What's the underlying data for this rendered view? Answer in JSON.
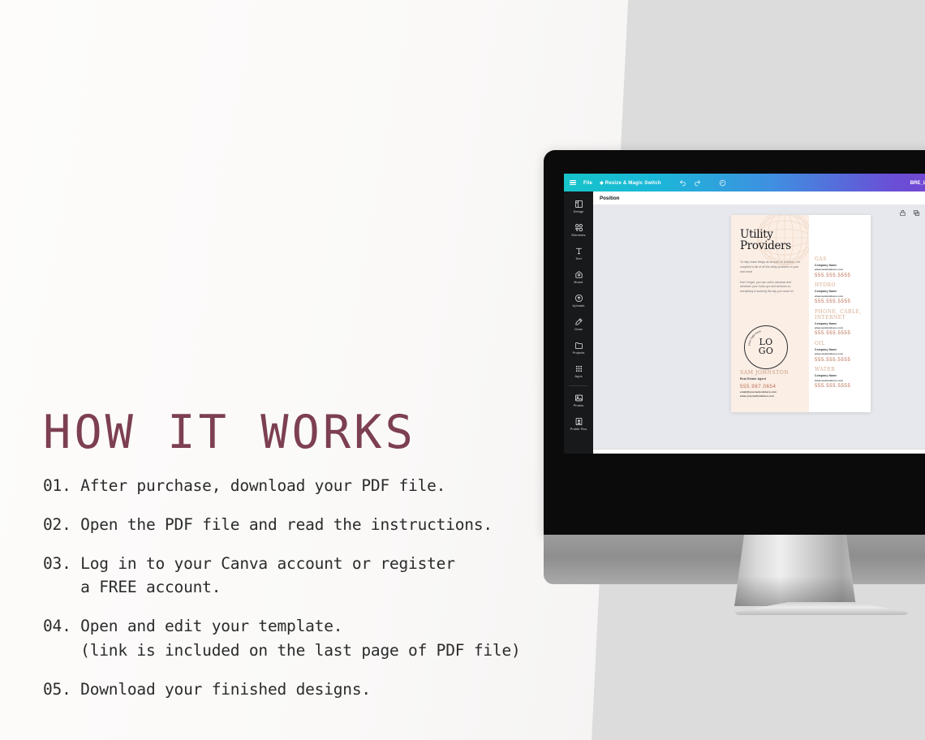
{
  "headline": "HOW IT WORKS",
  "accent_color": "#7d3f52",
  "steps": [
    "01. After purchase, download your PDF file.",
    "02. Open the PDF file and read the instructions.",
    "03. Log in to your Canva account or register\n    a FREE account.",
    "04. Open and edit your template.\n    (link is included on the last page of PDF file)",
    "05. Download your finished designs."
  ],
  "editor": {
    "topbar": {
      "menu_icon": "hamburger-icon",
      "file_label": "File",
      "resize_label": "Resize & Magic Switch",
      "undo_icon": "undo-icon",
      "redo_icon": "redo-icon",
      "cloud_icon": "cloud-sync-icon",
      "document_title": "BRE_LM_Utility-Provid"
    },
    "sidebar": [
      {
        "label": "Design",
        "icon": "design-icon"
      },
      {
        "label": "Elements",
        "icon": "elements-icon"
      },
      {
        "label": "Text",
        "icon": "text-icon"
      },
      {
        "label": "Brand",
        "icon": "brand-icon"
      },
      {
        "label": "Uploads",
        "icon": "uploads-icon"
      },
      {
        "label": "Draw",
        "icon": "draw-icon"
      },
      {
        "label": "Projects",
        "icon": "projects-icon"
      },
      {
        "label": "Apps",
        "icon": "apps-icon"
      },
      {
        "label": "Photos",
        "icon": "photos-icon"
      },
      {
        "label": "Profile Pics",
        "icon": "profile-pics-icon"
      }
    ],
    "position_label": "Position",
    "object_tools": [
      "lock-icon",
      "duplicate-icon",
      "share-icon"
    ],
    "rotate_icon": "rotate-icon"
  },
  "design": {
    "title_line1": "Utility",
    "title_line2": "Providers",
    "paragraph1": "To help make things as smooth as possible, I've compiled a list of all the utility providers in your new area!",
    "paragraph2": "Don't forget, you can call in advance and schedule your hook-ups and services so everything is working the day you move in!",
    "logo": {
      "arc_text": "your logo here",
      "line1": "LO",
      "line2": "GO"
    },
    "agent": {
      "name": "SAM JOHNSTON",
      "role": "Real Estate Agent",
      "phone": "555.987.0654",
      "email": "email@yourwebsitehere.com",
      "website": "www.yourwebsitehere.com"
    },
    "utilities": [
      {
        "name": "GAS",
        "company": "Company Name",
        "website": "www.websitehere.com",
        "phone": "555.555.5555"
      },
      {
        "name": "HYDRO",
        "company": "Company Name",
        "website": "www.websitehere.com",
        "phone": "555.555.5555"
      },
      {
        "name": "PHONE, CABLE, INTERNET",
        "company": "Company Name",
        "website": "www.websitehere.com",
        "phone": "555.555.5555"
      },
      {
        "name": "OIL",
        "company": "Company Name",
        "website": "www.websitehere.com",
        "phone": "555.555.5555"
      },
      {
        "name": "WATER",
        "company": "Company Name",
        "website": "www.websitehere.com",
        "phone": "555.555.5555"
      }
    ]
  }
}
